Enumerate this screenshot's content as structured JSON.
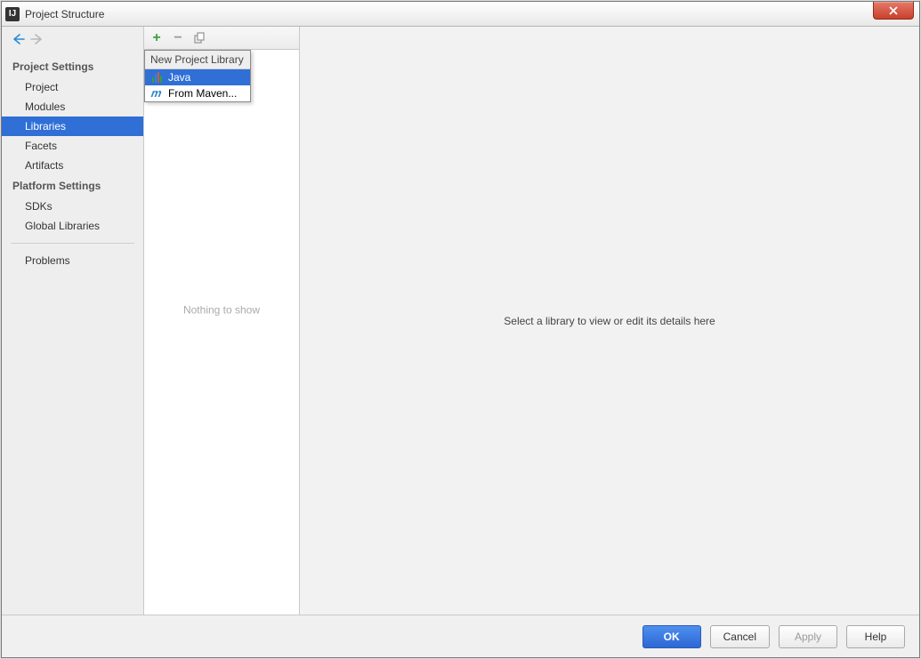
{
  "window": {
    "title": "Project Structure"
  },
  "sidebar": {
    "section1": "Project Settings",
    "items1": [
      "Project",
      "Modules",
      "Libraries",
      "Facets",
      "Artifacts"
    ],
    "selected1": 2,
    "section2": "Platform Settings",
    "items2": [
      "SDKs",
      "Global Libraries"
    ],
    "section3_items": [
      "Problems"
    ]
  },
  "mid": {
    "empty": "Nothing to show"
  },
  "popup": {
    "title": "New Project Library",
    "items": [
      {
        "icon": "library-icon",
        "label": "Java"
      },
      {
        "icon": "maven-icon",
        "label": "From Maven..."
      }
    ],
    "selected": 0
  },
  "detail": {
    "placeholder": "Select a library to view or edit its details here"
  },
  "buttons": {
    "ok": "OK",
    "cancel": "Cancel",
    "apply": "Apply",
    "help": "Help"
  }
}
